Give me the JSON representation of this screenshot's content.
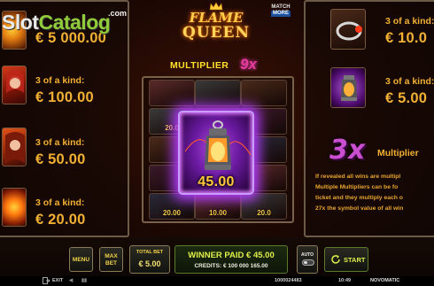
{
  "watermark": {
    "slot": "Slot",
    "catalog": "Catalog",
    "dotcom": ".com"
  },
  "logo": {
    "line1": "FLAME",
    "line2": "QUEEN"
  },
  "match_more": {
    "line1": "MATCH",
    "line2": "MORE"
  },
  "multiplier": {
    "label": "MULTIPLIER",
    "value": "9x"
  },
  "paytable_left": [
    {
      "label": "",
      "value": "€ 5 000.00",
      "symbol": "gold-ring"
    },
    {
      "label": "3 of a kind:",
      "value": "€ 100.00",
      "symbol": "red-queen"
    },
    {
      "label": "3 of a kind:",
      "value": "€ 50.00",
      "symbol": "flame-woman"
    },
    {
      "label": "3 of a kind:",
      "value": "€ 20.00",
      "symbol": "fire-orb"
    }
  ],
  "paytable_right": [
    {
      "label": "3 of a kind:",
      "value": "€ 10.0",
      "symbol": "silver-ring"
    },
    {
      "label": "3 of a kind:",
      "value": "€ 5.00",
      "symbol": "lantern"
    }
  ],
  "grid_cells": [
    {
      "amount": ""
    },
    {
      "amount": ""
    },
    {
      "amount": ""
    },
    {
      "amount": "20.0"
    },
    {
      "amount": ""
    },
    {
      "amount": ""
    },
    {
      "amount": ""
    },
    {
      "amount": ""
    },
    {
      "amount": ""
    },
    {
      "amount": ""
    },
    {
      "amount": ""
    },
    {
      "amount": ""
    },
    {
      "amount": "20.00"
    },
    {
      "amount": "10.00"
    },
    {
      "amount": "20.0"
    }
  ],
  "featured": {
    "amount": "45.00",
    "symbol": "lantern"
  },
  "multiplier_info": {
    "badge": "3x",
    "label": "Multiplier",
    "lines": [
      "If revealed all wins are multipl",
      "Multiple Multipliers can be fo",
      "ticket and they multiply each o",
      "27x the symbol value of all win"
    ]
  },
  "controls": {
    "menu": "MENU",
    "max_bet_line1": "MAX",
    "max_bet_line2": "BET",
    "total_bet_label": "TOTAL BET",
    "total_bet_value": "€ 5.00",
    "winner_paid": "WINNER PAID € 45.00",
    "credits": "CREDITS: € 100 000 165.00",
    "auto": "AUTO",
    "start": "START"
  },
  "status": {
    "exit": "EXIT",
    "ticket_id": "1000024483",
    "time": "10:49",
    "brand": "NOVOMATIC"
  },
  "colors": {
    "gold_text": "#f2b034",
    "multiplier_pink": "#e23c9c",
    "highlight_purple": "#b43cff"
  }
}
